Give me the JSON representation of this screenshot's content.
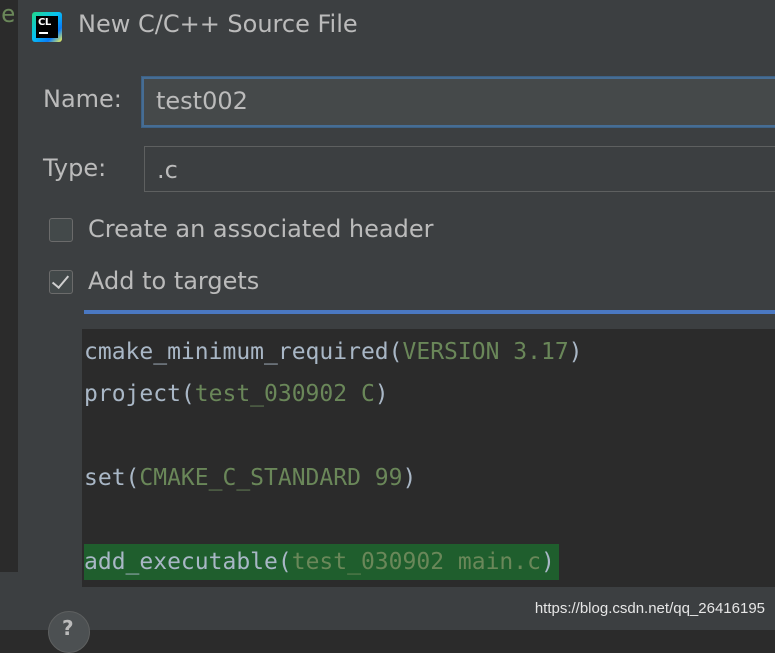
{
  "background": {
    "editor_letter": "e"
  },
  "dialog": {
    "title": "New C/C++ Source File",
    "app_icon_text": "CL",
    "name_label": "Name:",
    "name_value": "test002",
    "type_label": "Type:",
    "type_value": ".c",
    "create_header_label": "Create an associated header",
    "create_header_checked": false,
    "add_targets_label": "Add to targets",
    "add_targets_checked": true
  },
  "cmake": {
    "line1": {
      "func": "cmake_minimum_required(",
      "args": "VERSION 3.17",
      "close": ")"
    },
    "line2": {
      "func": "project(",
      "args": "test_030902 C",
      "close": ")"
    },
    "line3": {
      "func": "set(",
      "args": "CMAKE_C_STANDARD 99",
      "close": ")"
    },
    "line4": {
      "func": "add_executable(",
      "args": "test_030902 main.c",
      "close": ")"
    }
  },
  "footer": {
    "help_icon": "question-icon",
    "help_glyph": "?",
    "watermark": "https://blog.csdn.net/qq_26416195"
  },
  "colors": {
    "dialog_bg": "#3c3f41",
    "editor_bg": "#2b2b2b",
    "text": "#bbbbbb",
    "focus_border": "#466d94",
    "code_arg": "#6a8759",
    "code_func": "#a9b7c6",
    "highlight": "#1f5e2d"
  }
}
